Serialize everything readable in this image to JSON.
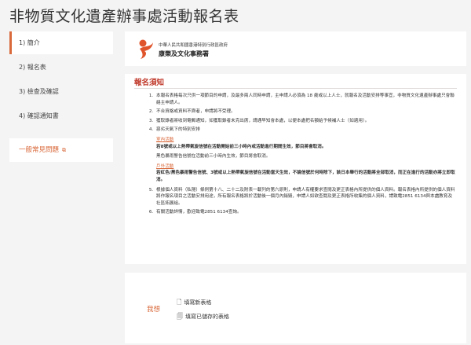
{
  "title": "非物質文化遺產辦事處活動報名表",
  "steps": [
    {
      "label": "1)  簡介"
    },
    {
      "label": "2)  報名表"
    },
    {
      "label": "3)  檢查及確認"
    },
    {
      "label": "4)  確認通知書"
    }
  ],
  "faq": {
    "label": "一般常見問題"
  },
  "logo": {
    "line1": "中華人民共和國香港特別行政區政府",
    "line2": "康樂及文化事務署"
  },
  "notes": {
    "heading": "報名須知",
    "items": [
      "本報名表格每次只供一項節目的申請，及最多兩人同時申請，主申請人必須為 18 歲或以上人士，就報名及活動安排等事宜，非物質文化遺產辦事處只會聯絡主申請人。",
      "不合資格或資料不齊者，申請將不受理。",
      "獲取錄者將收到電郵通知，如獲取錄者未克出席，請通早知會本處，以便本處把名額給予候補人士（如適用）。",
      "惡劣天氣下的特別安排",
      "根據個人資料（私隱）條例第十八、二十二及附表一載列的第六原則，申請人有權要求查閱及更正表格內所提供的個人資料。報名表格內所提供的個人資料將作報名項目之活動安排用途，所有報名表格將於活動後一個月內銷毀，申請人如欲查閱及更正表格所收集的個人資料，請致電2851 6134與本處教育及社區拓展組。",
      "有關活動詳情，歡迎致電2851 6134查詢。"
    ],
    "weather": {
      "indoor_title": "室內活動",
      "indoor_text": "若8號或以上熱帶氣旋信號在活動開始前三小時內或活動進行期間生效，節目將會取消。",
      "indoor_text2": "黑色暴雨警告信號在活動前三小時內生效，節目將會取消。",
      "outdoor_title": "戶外活動",
      "outdoor_text": "若紅色/黑色暴雨警告信號、3號或以上熱帶氣旋信號在活動當天生效，不論信號於何時除下，該日本舉行的活動將全部取消，而正在進行的活動亦將立即取消。"
    }
  },
  "action": {
    "want_label": "我想",
    "new_form": "填寫新表格",
    "saved_form": "填寫已儲存的表格"
  },
  "colors": {
    "accent": "#d9683a",
    "heading": "#c0392b"
  }
}
